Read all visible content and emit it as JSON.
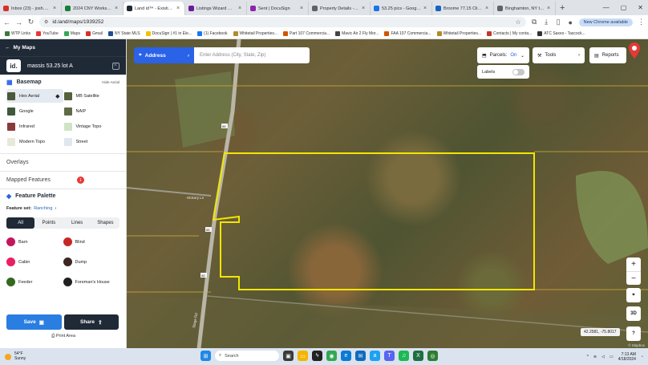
{
  "browser": {
    "tabs": [
      {
        "title": "Inbox (23) - josh.burr",
        "color": "#d93025"
      },
      {
        "title": "2024 CNY Worksheet",
        "color": "#188038"
      },
      {
        "title": "Land id™ - Existing M",
        "color": "#1f2a36",
        "active": true
      },
      {
        "title": "Listings Wizard — Mls",
        "color": "#6a1b9a"
      },
      {
        "title": "Sent | DocuSign",
        "color": "#8e24aa"
      },
      {
        "title": "Property Details - Inn",
        "color": "#5f6368"
      },
      {
        "title": "53.25 pics - Google D",
        "color": "#1a73e8"
      },
      {
        "title": "Broome 77.15 Clifton",
        "color": "#1565c0"
      },
      {
        "title": "Binghamton, NY to Fr",
        "color": "#5f6368"
      }
    ],
    "url": "id.land/maps/1939252",
    "update_label": "New Chrome available",
    "bookmarks": [
      {
        "label": "WTP Links",
        "color": "#3b7a3b"
      },
      {
        "label": "YouTube",
        "color": "#e53935"
      },
      {
        "label": "Maps",
        "color": "#34a853"
      },
      {
        "label": "Gmail",
        "color": "#d93025"
      },
      {
        "label": "NY State MLS",
        "color": "#1f4e8c"
      },
      {
        "label": "DocuSign | #1 in Ele...",
        "color": "#f2c200"
      },
      {
        "label": "(1) Facebook",
        "color": "#1877f2"
      },
      {
        "label": "Whitetail Properties...",
        "color": "#b08d2a"
      },
      {
        "label": "Part 107 Commercia...",
        "color": "#d35400"
      },
      {
        "label": "Mavic Air 2 Fly Mor...",
        "color": "#444444"
      },
      {
        "label": "FAA 107 Commercia...",
        "color": "#d35400"
      },
      {
        "label": "Whitetail Properties...",
        "color": "#b08d2a"
      },
      {
        "label": "Contacts | My conta...",
        "color": "#c0392b"
      },
      {
        "label": "ATC Saxes - Tascock...",
        "color": "#333333"
      }
    ]
  },
  "panel": {
    "header": "My Maps",
    "logo": "id.",
    "project_name": "massis 53.25 lot A",
    "basemap": {
      "title": "Basemap",
      "more": "Hide Aerial",
      "items": [
        {
          "label": "Hex Aerial",
          "color": "#4a5a3a",
          "selected": true
        },
        {
          "label": "MB Satellite",
          "color": "#55603e"
        },
        {
          "label": "Google",
          "color": "#3f5a3a"
        },
        {
          "label": "NAIP",
          "color": "#5e6b45"
        },
        {
          "label": "Infrared",
          "color": "#8a3a3a"
        },
        {
          "label": "Vintage Topo",
          "color": "#cfe3c5"
        },
        {
          "label": "Modern Topo",
          "color": "#e6e9d8"
        },
        {
          "label": "Street",
          "color": "#dfe7ef"
        }
      ]
    },
    "overlays": "Overlays",
    "mapped_features": "Mapped Features",
    "mapped_count": "1",
    "feature_palette": {
      "title": "Feature Palette",
      "set_label": "Feature set:",
      "set_value": "Ranching",
      "tabs": [
        "All",
        "Points",
        "Lines",
        "Shapes"
      ],
      "items": [
        {
          "label": "Barn",
          "color": "#c2185b"
        },
        {
          "label": "Blind",
          "color": "#c62828"
        },
        {
          "label": "Cabin",
          "color": "#e91e63"
        },
        {
          "label": "Dump",
          "color": "#3e2723"
        },
        {
          "label": "Feeder",
          "color": "#33691e"
        },
        {
          "label": "Foreman's House",
          "color": "#212121"
        }
      ]
    },
    "save_label": "Save",
    "share_label": "Share",
    "print_label": "Print Area"
  },
  "map": {
    "address_label": "Address",
    "address_placeholder": "Enter Address (City, State, Zip)",
    "parcels_label": "Parcels:",
    "parcels_value": "On",
    "tools_label": "Tools",
    "reports_label": "Reports",
    "labels_label": "Labels",
    "zoom_in": "+",
    "zoom_out": "−",
    "btn_3d": "3D",
    "btn_help": "?",
    "coords": "42.2581, -75.8017",
    "attribution": "© Mapbox",
    "road_labels": [
      "88",
      "Hickory Ln",
      "88",
      "88",
      "Stage Rd"
    ],
    "parcel_color": "#f2e600"
  },
  "taskbar": {
    "temp": "54°F",
    "weather": "Sunny",
    "search": "Search",
    "time": "7:13 AM",
    "date": "4/18/2024"
  }
}
